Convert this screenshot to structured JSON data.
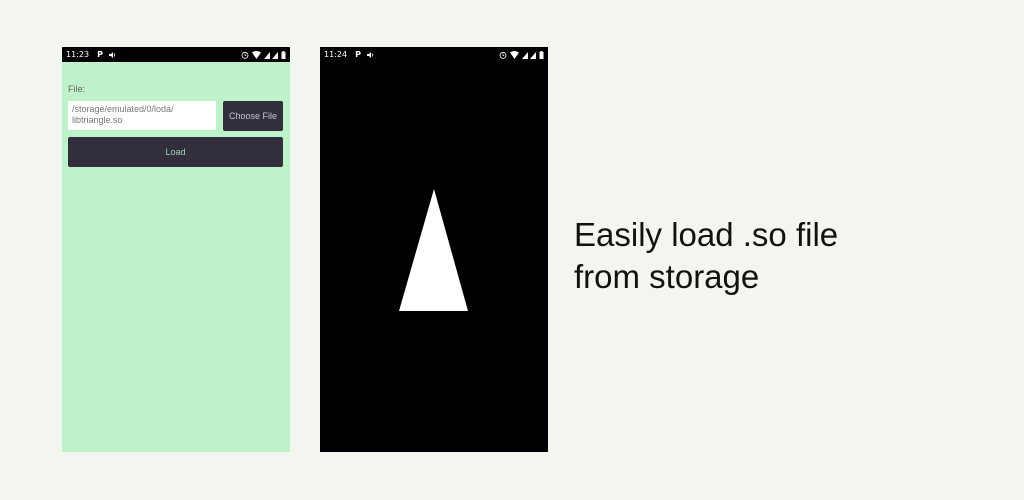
{
  "screen1": {
    "status": {
      "time": "11:23",
      "app_glyph": "P"
    },
    "file_label": "File:",
    "path_value": "/storage/emulated/0/loda/\nlibtriangle.so",
    "choose_button": "Choose File",
    "load_button": "Load",
    "background": "#bdf2cb"
  },
  "screen2": {
    "status": {
      "time": "11:24",
      "app_glyph": "P"
    },
    "background": "#000000",
    "shape": "white-triangle"
  },
  "caption": {
    "line1": "Easily load .so file",
    "line2": "from storage"
  },
  "colors": {
    "page_bg": "#f5f5f0",
    "button_bg": "#322e3c",
    "triangle": "#ffffff"
  },
  "icons": [
    "volume-icon",
    "alarm-icon",
    "wifi-icon",
    "signal-icon",
    "battery-icon"
  ]
}
